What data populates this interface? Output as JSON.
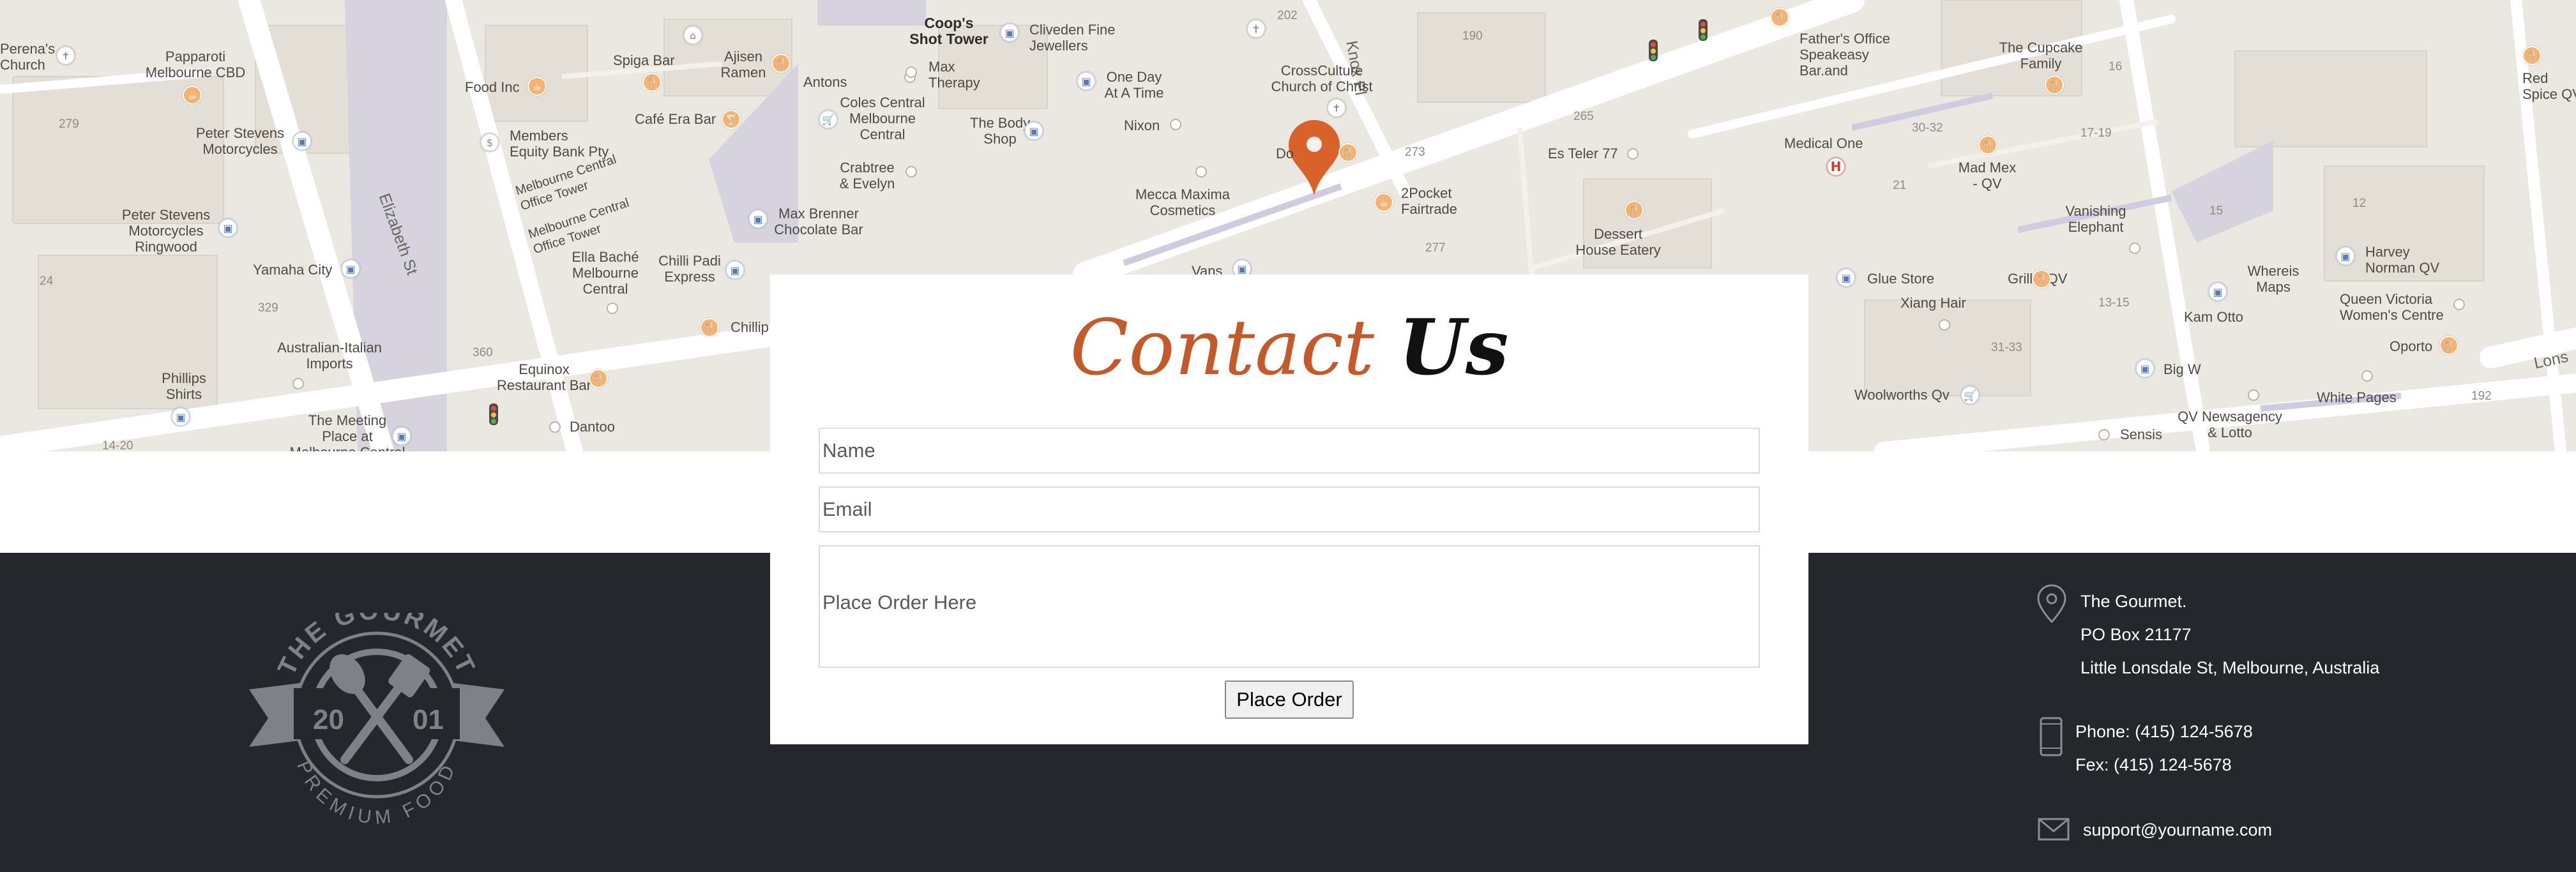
{
  "map": {
    "pin_color": "#d9612a",
    "street_labels": [
      "Elizabeth St",
      "Knox Pl",
      "Lons"
    ],
    "places": [
      {
        "name": "Perena's\nChurch",
        "icon": "gen"
      },
      {
        "name": "Papparoti\nMelbourne CBD",
        "icon": "food"
      },
      {
        "name": "Peter Stevens\nMotorcycles",
        "icon": "shop"
      },
      {
        "name": "Peter Stevens\nMotorcycles\nRingwood",
        "icon": "shop"
      },
      {
        "name": "Yamaha City",
        "icon": "shop"
      },
      {
        "name": "Australian-Italian\nImports",
        "icon": "dot"
      },
      {
        "name": "Phillips\nShirts",
        "icon": "shop"
      },
      {
        "name": "The Meeting\nPlace at\nMelbourne Central",
        "icon": "shop"
      },
      {
        "name": "Food Inc",
        "icon": "food"
      },
      {
        "name": "Spiga Bar",
        "icon": "food"
      },
      {
        "name": "Café Era Bar",
        "icon": "food"
      },
      {
        "name": "Members\nEquity Bank Pty",
        "icon": "bank"
      },
      {
        "name": "Melbourne Central\nOffice Tower",
        "icon": ""
      },
      {
        "name": "Melbourne Central\nOffice Tower",
        "icon": ""
      },
      {
        "name": "Ella Baché\nMelbourne\nCentral",
        "icon": "dot"
      },
      {
        "name": "Chilli Padi\nExpress",
        "icon": "shop"
      },
      {
        "name": "Chillip",
        "icon": "food"
      },
      {
        "name": "Equinox\nRestaurant Bar",
        "icon": "food"
      },
      {
        "name": "Dantoo",
        "icon": "dot"
      },
      {
        "name": "Ajisen\nRamen",
        "icon": "food"
      },
      {
        "name": "Antons",
        "icon": "dot"
      },
      {
        "name": "Coles Central\nMelbourne\nCentral",
        "icon": "shop"
      },
      {
        "name": "Crabtree\n& Evelyn",
        "icon": "dot"
      },
      {
        "name": "Max Brenner\nChocolate Bar",
        "icon": "shop"
      },
      {
        "name": "Coop's\nShot Tower",
        "icon": ""
      },
      {
        "name": "Max\nTherapy",
        "icon": "dot"
      },
      {
        "name": "The Body\nShop",
        "icon": "shop"
      },
      {
        "name": "Cliveden Fine\nJewellers",
        "icon": "shop"
      },
      {
        "name": "One Day\nAt A Time",
        "icon": "shop"
      },
      {
        "name": "Nixon",
        "icon": "dot"
      },
      {
        "name": "Mecca Maxima\nCosmetics",
        "icon": "dot"
      },
      {
        "name": "Vans",
        "icon": "shop"
      },
      {
        "name": "CrossCulture\nChurch of Christ",
        "icon": "gen"
      },
      {
        "name": "Do",
        "icon": "food"
      },
      {
        "name": "2Pocket\nFairtrade",
        "icon": "food"
      },
      {
        "name": "Es Teler 77",
        "icon": "dot"
      },
      {
        "name": "Dessert\nHouse Eatery",
        "icon": "food"
      },
      {
        "name": "Father's Office\nSpeakeasy\nBar.and",
        "icon": "food"
      },
      {
        "name": "Medical One",
        "icon": "hosp"
      },
      {
        "name": "The Cupcake\nFamily",
        "icon": "food"
      },
      {
        "name": "Mad Mex\n- QV",
        "icon": "food"
      },
      {
        "name": "Vanishing\nElephant",
        "icon": "dot"
      },
      {
        "name": "Glue Store",
        "icon": "shop"
      },
      {
        "name": "Grill'd QV",
        "icon": "food"
      },
      {
        "name": "Xiang Hair",
        "icon": "dot"
      },
      {
        "name": "Woolworths Qv",
        "icon": "shop"
      },
      {
        "name": "Big W",
        "icon": "shop"
      },
      {
        "name": "Kam Otto",
        "icon": "shop"
      },
      {
        "name": "Whereis\nMaps",
        "icon": "dot"
      },
      {
        "name": "QV Newsagency\n& Lotto",
        "icon": "dot"
      },
      {
        "name": "Sensis",
        "icon": "dot"
      },
      {
        "name": "Harvey\nNorman QV",
        "icon": "shop"
      },
      {
        "name": "Queen Victoria\nWomen's Centre",
        "icon": "dot"
      },
      {
        "name": "Oporto",
        "icon": "food"
      },
      {
        "name": "White Pages",
        "icon": "dot"
      },
      {
        "name": "Red\nSpice QV",
        "icon": "food"
      }
    ],
    "numbers": [
      "279",
      "24",
      "329",
      "360",
      "14-20",
      "202",
      "190",
      "265",
      "273",
      "277",
      "30-32",
      "21",
      "16",
      "17-19",
      "15",
      "12",
      "13-15",
      "31-33",
      "192"
    ]
  },
  "contact": {
    "title_part1": "Contact",
    "title_part2": "Us",
    "name_placeholder": "Name",
    "email_placeholder": "Email",
    "order_placeholder": "Place Order Here",
    "submit_label": "Place Order",
    "accent_color": "#c45a2a"
  },
  "footer": {
    "logo": {
      "top_text": "THE GOURMET",
      "bottom_text": "PREMIUM FOOD",
      "year_left": "20",
      "year_right": "01"
    },
    "address": {
      "company": "The Gourmet.",
      "po_box": "PO Box 21177",
      "street": "Little Lonsdale St, Melbourne, Australia"
    },
    "phone": "Phone: (415) 124-5678",
    "fax": "Fex: (415) 124-5678",
    "email": "support@yourname.com",
    "background": "#24282d"
  }
}
